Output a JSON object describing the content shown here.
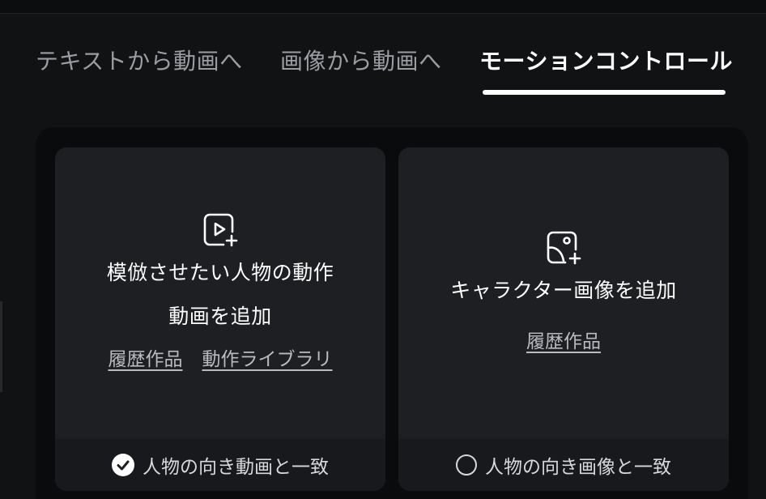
{
  "tabs": [
    {
      "label": "テキストから動画へ",
      "active": false
    },
    {
      "label": "画像から動画へ",
      "active": false
    },
    {
      "label": "モーションコントロール",
      "active": true
    }
  ],
  "colors": {
    "background": "#111214",
    "card": "#1d1f23",
    "card_footer": "#17191c",
    "active_tab": "#ffffff",
    "inactive_tab": "#9b9da2"
  },
  "cards": {
    "motion": {
      "icon": "video-add-icon",
      "title_line1": "模倣させたい人物の動作",
      "title_line2": "動画を追加",
      "link_history": "履歴作品",
      "link_library": "動作ライブラリ",
      "footer_label": "人物の向き動画と一致",
      "footer_checked": true
    },
    "character": {
      "icon": "image-add-icon",
      "title": "キャラクター画像を追加",
      "link_history": "履歴作品",
      "footer_label": "人物の向き画像と一致",
      "footer_checked": false
    }
  }
}
